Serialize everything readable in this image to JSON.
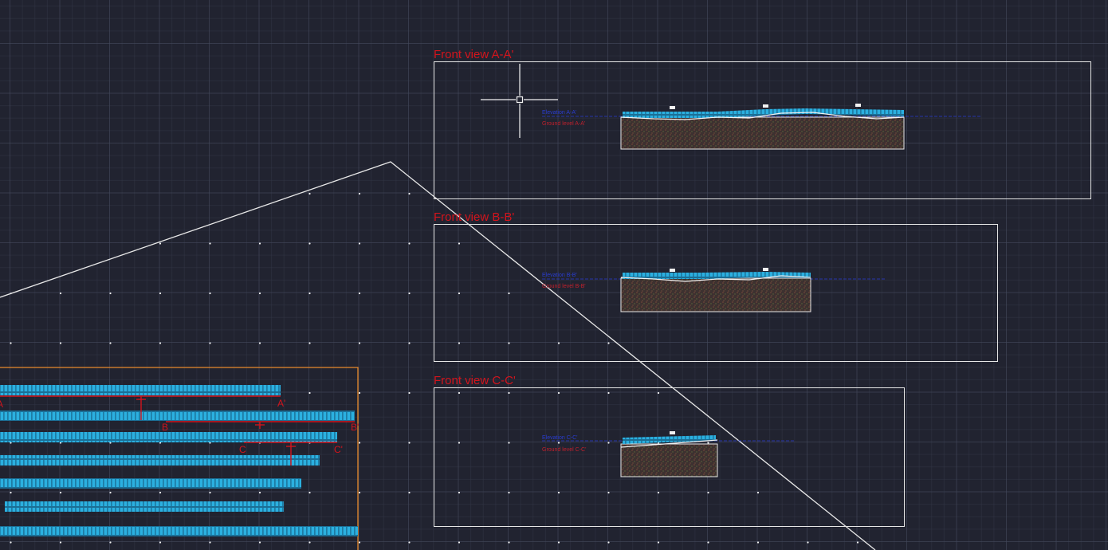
{
  "app": {
    "name": "CAD drawing canvas"
  },
  "views": [
    {
      "id": "a",
      "title": "Front view A-A'",
      "label_top": "Elevation A-A'",
      "label_bottom": "Ground level A-A'"
    },
    {
      "id": "b",
      "title": "Front view B-B'",
      "label_top": "Elevation B-B'",
      "label_bottom": "Ground level B-B'"
    },
    {
      "id": "c",
      "title": "Front view C-C'",
      "label_top": "Elevation C-C'",
      "label_bottom": "Ground level C-C'"
    }
  ],
  "sections": {
    "a_start": "A",
    "a_end": "A'",
    "b_start": "B",
    "b_end": "B'",
    "c_start": "C",
    "c_end": "C'"
  },
  "colors": {
    "background": "#212330",
    "view_title": "#d3141c",
    "section_line": "#d3141c",
    "frame": "#e6e6e6",
    "panel_rows": "#1e9ac8",
    "site_boundary": "#e8892a",
    "profile_label_top": "#2a3dd0",
    "profile_label_bottom": "#c0202c",
    "soil_fill": "#4a3a33"
  },
  "icons": {
    "cursor": "crosshair-cursor-icon"
  }
}
